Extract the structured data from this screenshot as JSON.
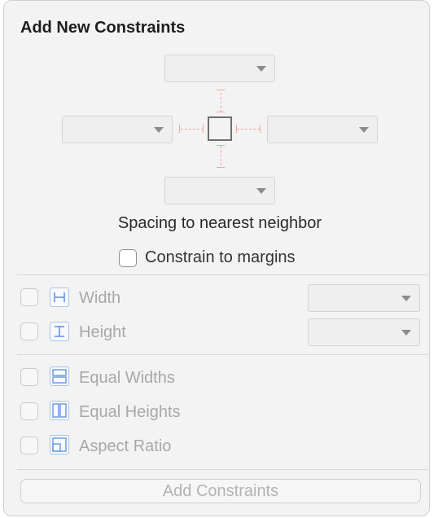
{
  "panel": {
    "title": "Add New Constraints",
    "spacing_label": "Spacing to nearest neighbor",
    "constrain_to_margins_label": "Constrain to margins"
  },
  "size_rows": [
    {
      "label": "Width",
      "icon": "width-icon"
    },
    {
      "label": "Height",
      "icon": "height-icon"
    }
  ],
  "equal_rows": [
    {
      "label": "Equal Widths",
      "icon": "equal-widths-icon"
    },
    {
      "label": "Equal Heights",
      "icon": "equal-heights-icon"
    },
    {
      "label": "Aspect Ratio",
      "icon": "aspect-ratio-icon"
    }
  ],
  "add_button_label": "Add Constraints",
  "colors": {
    "panel_bg": "#f3f3f3",
    "spacing_indicator": "#f0a3a3",
    "icon_accent": "#5b8fdc",
    "disabled_text": "#a8a8a8"
  }
}
